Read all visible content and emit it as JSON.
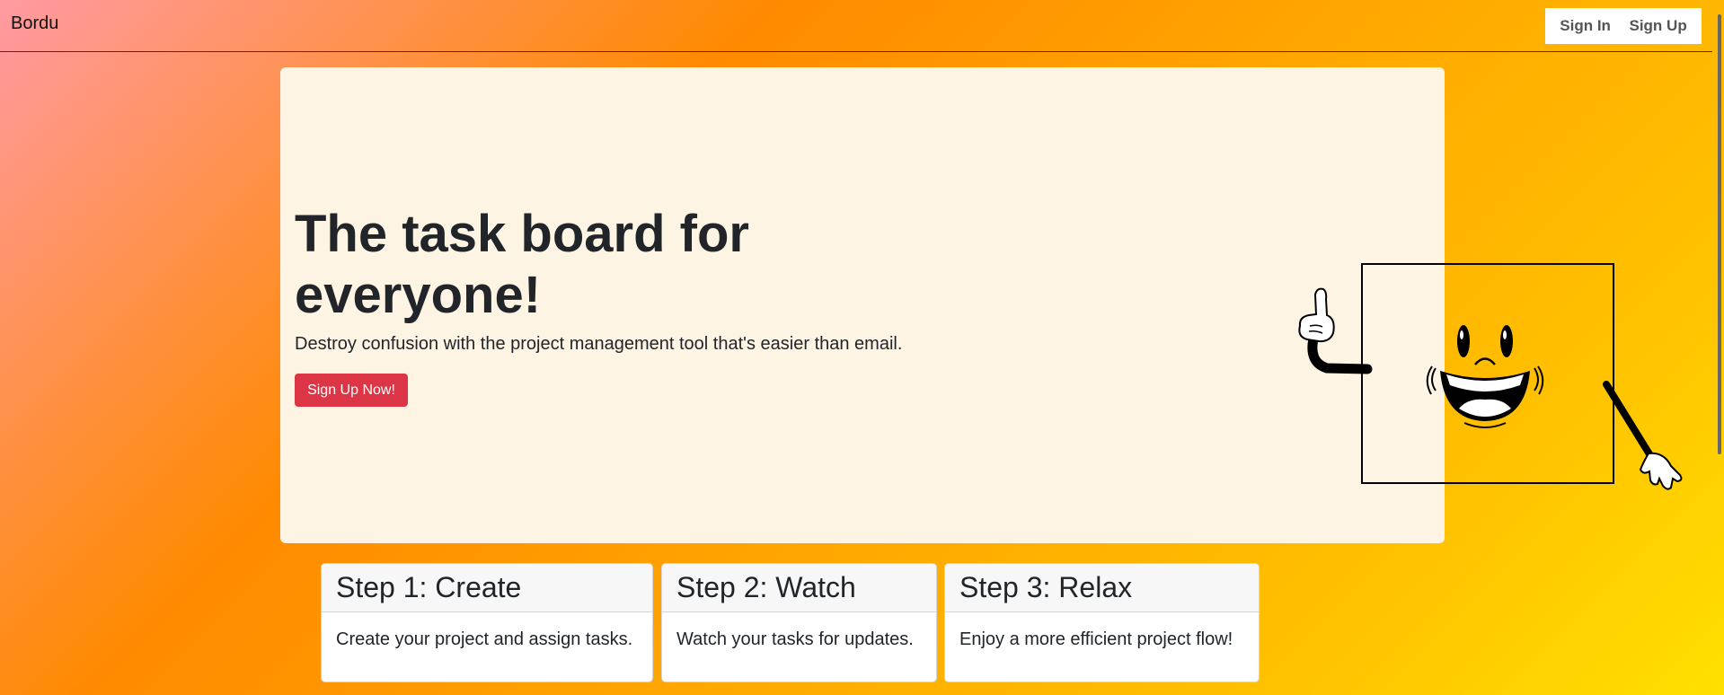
{
  "navbar": {
    "brand": "Bordu",
    "sign_in": "Sign In",
    "sign_up": "Sign Up"
  },
  "hero": {
    "title": "The task board for everyone!",
    "subtitle": "Destroy confusion with the project management tool that's easier than email.",
    "cta": "Sign Up Now!",
    "illustration_icon": "smiling-board-mascot-icon"
  },
  "steps": [
    {
      "title": "Step 1: Create",
      "text": "Create your project and assign tasks."
    },
    {
      "title": "Step 2: Watch",
      "text": "Watch your tasks for updates."
    },
    {
      "title": "Step 3: Relax",
      "text": "Enjoy a more efficient project flow!"
    }
  ],
  "colors": {
    "cta": "#dc3545",
    "hero_bg": "#fdf4e4",
    "gradient_start": "#ff9aa2",
    "gradient_mid": "#ff8a00",
    "gradient_end": "#ffe000"
  }
}
